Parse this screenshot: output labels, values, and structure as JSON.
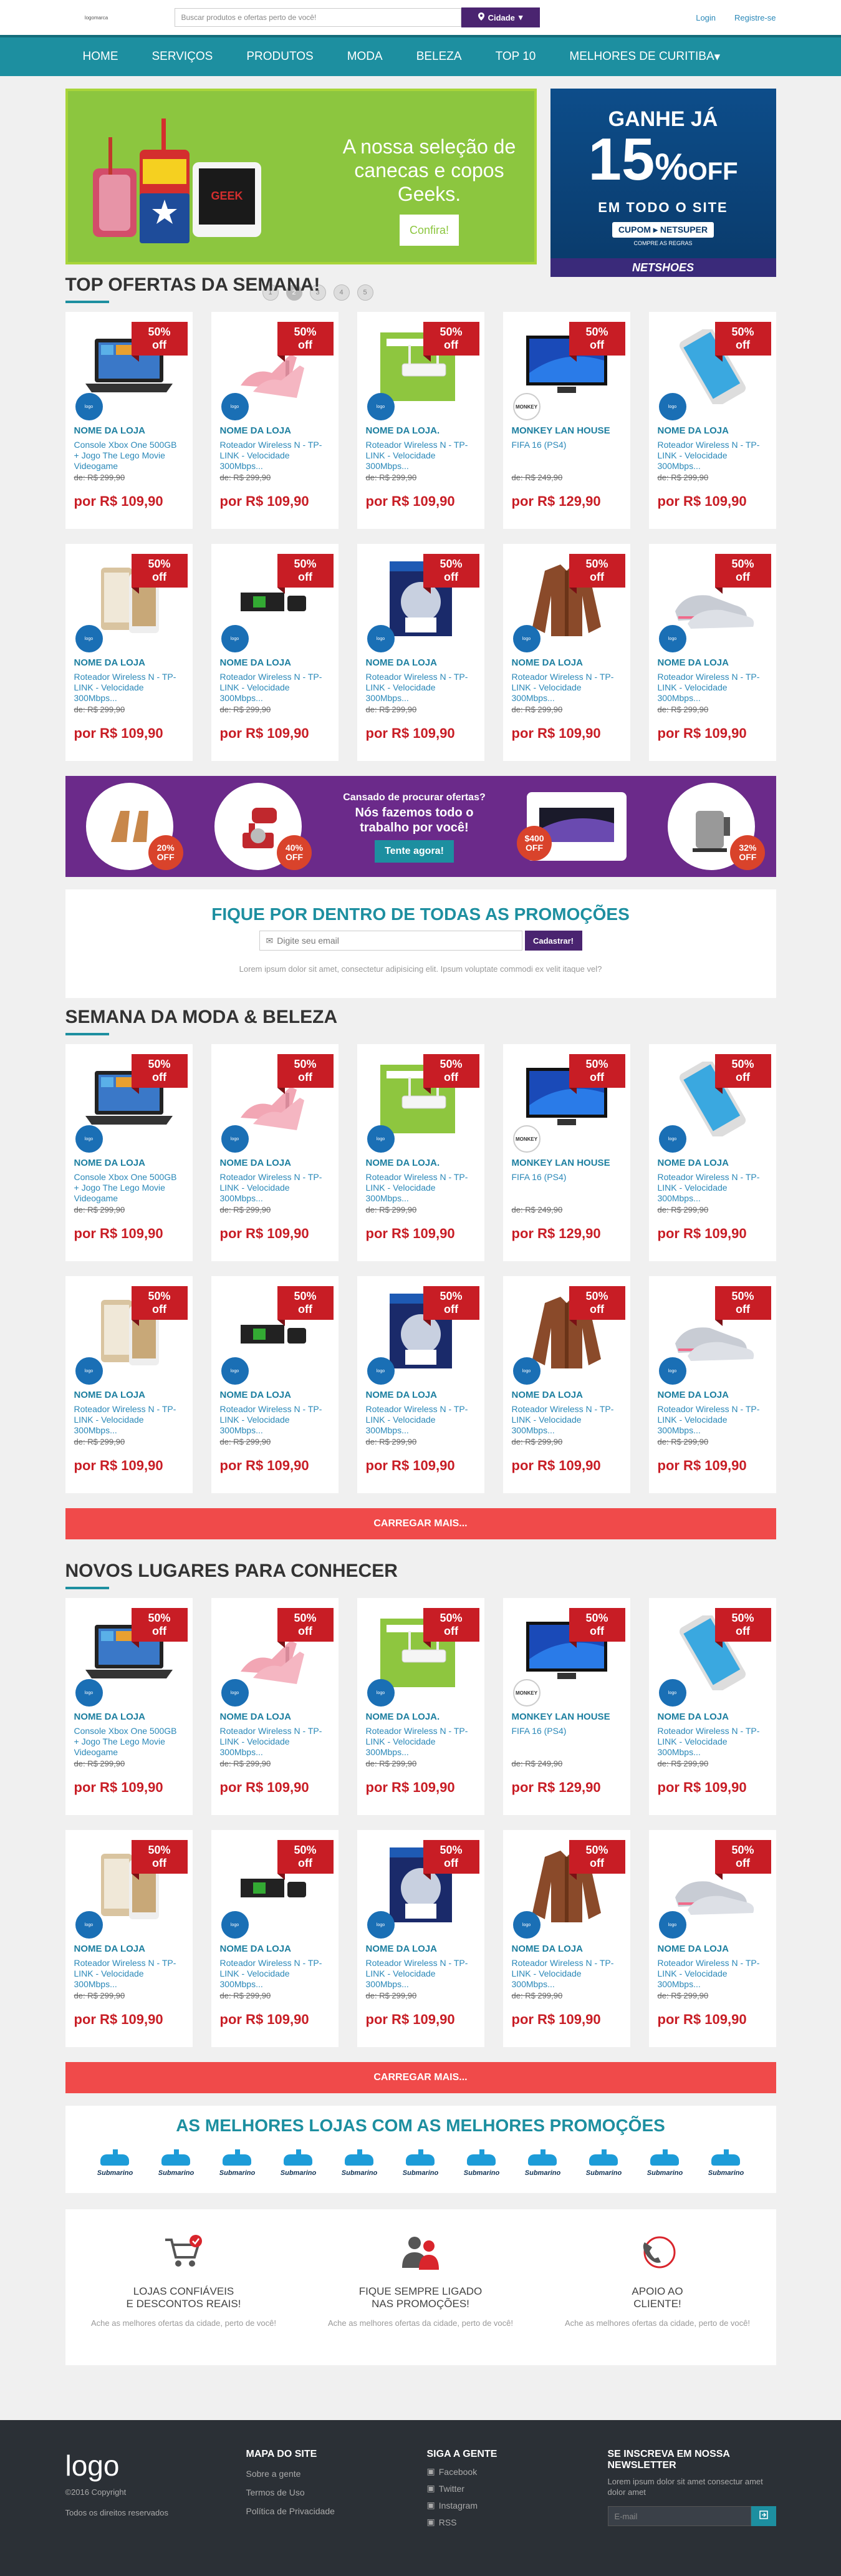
{
  "topbar": {
    "logo_text": "logomarca",
    "search_placeholder": "Buscar produtos e ofertas perto de você!",
    "city_label": "Cidade",
    "login_label": "Login",
    "register_label": "Registre-se"
  },
  "nav": {
    "items": [
      "HOME",
      "SERVIÇOS",
      "PRODUTOS",
      "MODA",
      "BELEZA",
      "TOP 10",
      "MELHORES DE CURITIBA"
    ]
  },
  "banner_main": {
    "text_line1": "A nossa seleção de",
    "text_line2": "canecas e copos Geeks.",
    "cta": "Confira!"
  },
  "banner_side": {
    "line1": "GANHE JÁ",
    "percent": "15",
    "percent_sign": "%",
    "off": "OFF",
    "line2": "EM TODO O SITE",
    "coupon": "CUPOM ▸ NETSUPER",
    "small": "COMPRE AS REGRAS",
    "brand": "NETSHOES"
  },
  "carousel_dots": [
    "1",
    "2",
    "3",
    "4",
    "5"
  ],
  "carousel_active": 1,
  "sections": {
    "top_offers": "TOP OFERTAS DA SEMANA!",
    "fashion": "SEMANA DA MODA & BELEZA",
    "places": "NOVOS LUGARES PARA CONHECER"
  },
  "products_row1": [
    {
      "badge": "50% off",
      "store": "NOME DA LOJA",
      "name": "Console Xbox One 500GB + Jogo The Lego Movie Videogame",
      "old_prefix": "de: ",
      "old": "R$ 299,90",
      "price": "por R$ 109,90",
      "store_logo": "logo",
      "img": "laptop"
    },
    {
      "badge": "50% off",
      "store": "NOME DA LOJA",
      "name": "Roteador Wireless N - TP-LINK - Velocidade 300Mbps...",
      "old_prefix": "de: ",
      "old": "R$ 299,90",
      "price": "por R$ 109,90",
      "store_logo": "logo",
      "img": "shoes"
    },
    {
      "badge": "50% off",
      "store": "NOME DA LOJA.",
      "name": "Roteador Wireless N - TP-LINK - Velocidade 300Mbps...",
      "old_prefix": "de: ",
      "old": "R$ 299,90",
      "price": "por R$ 109,90",
      "store_logo": "logo",
      "img": "router"
    },
    {
      "badge": "50% off",
      "store": "MONKEY LAN HOUSE",
      "name": "FIFA 16 (PS4)",
      "old_prefix": "de: ",
      "old": "R$ 249,90",
      "price": "por R$ 129,90",
      "store_logo": "MONKEY",
      "img": "tv"
    },
    {
      "badge": "50% off",
      "store": "NOME DA LOJA",
      "name": "Roteador Wireless N - TP-LINK - Velocidade 300Mbps...",
      "old_prefix": "de: ",
      "old": "R$ 299,90",
      "price": "por R$ 109,90",
      "store_logo": "logo",
      "img": "phone"
    }
  ],
  "products_row2": [
    {
      "badge": "50% off",
      "store": "NOME DA LOJA",
      "name": "Roteador Wireless N - TP-LINK - Velocidade 300Mbps...",
      "old_prefix": "de: ",
      "old": "R$ 299,90",
      "price": "por R$ 109,90",
      "store_logo": "logo",
      "img": "phones"
    },
    {
      "badge": "50% off",
      "store": "NOME DA LOJA",
      "name": "Roteador Wireless N - TP-LINK - Velocidade 300Mbps...",
      "old_prefix": "de: ",
      "old": "R$ 299,90",
      "price": "por R$ 109,90",
      "store_logo": "logo",
      "img": "xbox"
    },
    {
      "badge": "50% off",
      "store": "NOME DA LOJA",
      "name": "Roteador Wireless N - TP-LINK - Velocidade 300Mbps...",
      "old_prefix": "de: ",
      "old": "R$ 299,90",
      "price": "por R$ 109,90",
      "store_logo": "logo",
      "img": "fifa"
    },
    {
      "badge": "50% off",
      "store": "NOME DA LOJA",
      "name": "Roteador Wireless N - TP-LINK - Velocidade 300Mbps...",
      "old_prefix": "de: ",
      "old": "R$ 299,90",
      "price": "por R$ 109,90",
      "store_logo": "logo",
      "img": "jacket"
    },
    {
      "badge": "50% off",
      "store": "NOME DA LOJA",
      "name": "Roteador Wireless N - TP-LINK - Velocidade 300Mbps...",
      "old_prefix": "de: ",
      "old": "R$ 299,90",
      "price": "por R$ 109,90",
      "store_logo": "logo",
      "img": "sneakers"
    }
  ],
  "promo": {
    "tag1": "20% OFF",
    "tag2": "40% OFF",
    "line1": "Cansado de procurar ofertas?",
    "line2": "Nós fazemos todo o",
    "line3": "trabalho por você!",
    "cta": "Tente agora!",
    "tag3": "$400 OFF",
    "tag4": "32% OFF"
  },
  "newsletter": {
    "title": "FIQUE POR DENTRO DE TODAS AS PROMOÇÕES",
    "placeholder": "Digite seu email",
    "button": "Cadastrar!",
    "text": "Lorem ipsum dolor sit amet, consectetur adipisicing elit. Ipsum voluptate commodi ex velit itaque vel?"
  },
  "load_more": "CARREGAR MAIS...",
  "stores": {
    "title": "AS MELHORES LOJAS COM AS MELHORES PROMOÇÕES",
    "names": [
      "Submarino",
      "Submarino",
      "Submarino",
      "Submarino",
      "Submarino",
      "Submarino",
      "Submarino",
      "Submarino",
      "Submarino",
      "Submarino",
      "Submarino"
    ]
  },
  "features": [
    {
      "title1": "LOJAS CONFIÁVEIS",
      "title2": "E DESCONTOS REAIS!",
      "text": "Ache as melhores ofertas da cidade, perto de você!",
      "icon": "cart-icon"
    },
    {
      "title1": "FIQUE SEMPRE LIGADO",
      "title2": "NAS PROMOÇÕES!",
      "text": "Ache as melhores ofertas da cidade, perto de você!",
      "icon": "users-icon"
    },
    {
      "title1": "APOIO AO",
      "title2": "CLIENTE!",
      "text": "Ache as melhores ofertas da cidade, perto de você!",
      "icon": "phone-support-icon"
    }
  ],
  "footer": {
    "logo": "logo",
    "copyright": "©2016 Copyright",
    "rights": "Todos os direitos reservados",
    "sitemap_title": "MAPA DO SITE",
    "sitemap": [
      "Sobre a gente",
      "Termos de Uso",
      "Política de Privacidade"
    ],
    "social_title": "SIGA A GENTE",
    "social": [
      "Facebook",
      "Twitter",
      "Instagram",
      "RSS"
    ],
    "nl_title": "SE INSCREVA EM NOSSA NEWSLETTER",
    "nl_text": "Lorem ipsum dolor sit amet consectur amet dolor amet",
    "nl_placeholder": "E-mail"
  },
  "colors": {
    "teal": "#1d8fa0",
    "purple": "#4a2470",
    "red": "#c81d25",
    "load_more": "#f04a4a",
    "footer": "#2b3036"
  }
}
